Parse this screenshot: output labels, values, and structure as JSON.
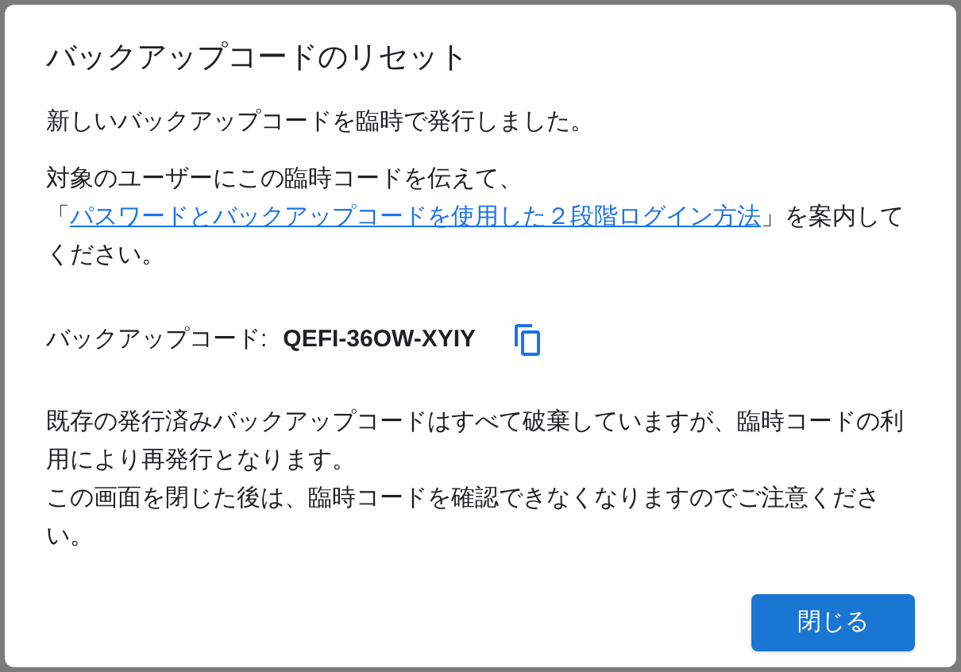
{
  "dialog": {
    "title": "バックアップコードのリセット",
    "message": "新しいバックアップコードを臨時で発行しました。",
    "instruction": {
      "before": "対象のユーザーにこの臨時コードを伝えて、「",
      "link": "パスワードとバックアップコードを使用した２段階ログイン方法",
      "after": "」を案内してください。"
    },
    "code": {
      "label": "バックアップコード:",
      "value": "QEFI-36OW-XYIY"
    },
    "notes": [
      "既存の発行済みバックアップコードはすべて破棄していますが、臨時コードの利用により再発行となります。",
      "この画面を閉じた後は、臨時コードを確認できなくなりますのでご注意ください。"
    ],
    "buttons": [
      "閉じる"
    ]
  }
}
